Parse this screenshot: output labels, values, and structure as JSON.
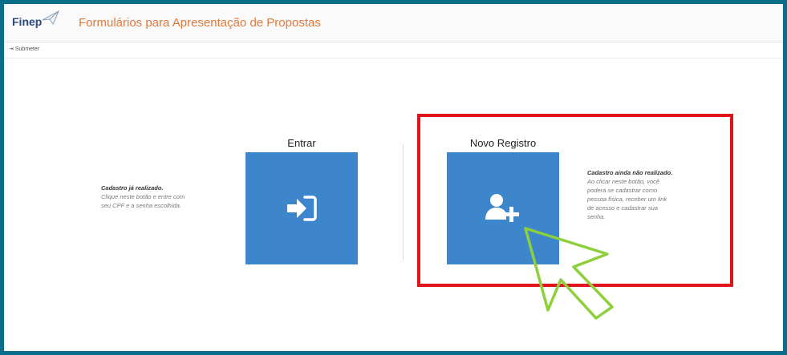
{
  "header": {
    "logo_text": "Finep",
    "title": "Formulários para Apresentação de Propostas"
  },
  "subbar": {
    "link_label": "Submeter",
    "link_icon": "sign-in-icon"
  },
  "login_tile": {
    "title": "Entrar",
    "icon": "sign-in-icon",
    "desc_strong": "Cadastro já realizado.",
    "desc_line1": "Clique neste botão e entre com",
    "desc_line2": "seu CPF e a senha escolhida."
  },
  "register_tile": {
    "title": "Novo Registro",
    "icon": "user-plus-icon",
    "desc_strong": "Cadastro ainda não realizado.",
    "desc_lines": [
      "Ao clicar neste botão, você",
      "poderá se cadastrar como",
      "pessoa física, receber um link",
      "de acesso e cadastrar sua",
      "senha."
    ]
  },
  "colors": {
    "tile_blue": "#3d86cc",
    "title_orange": "#e07a3c",
    "highlight_red": "#e0121b",
    "cursor_green": "#8ecf3c"
  }
}
